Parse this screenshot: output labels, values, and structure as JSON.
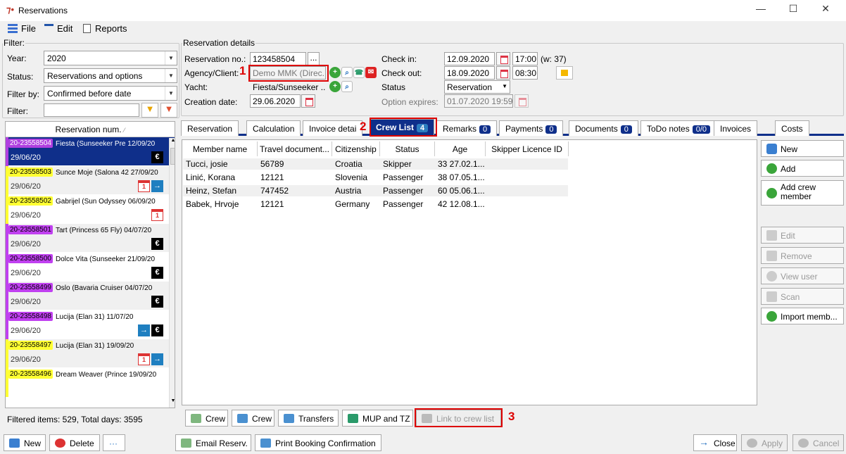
{
  "window": {
    "title": "Reservations",
    "min": "—",
    "max": "☐",
    "close": "✕"
  },
  "menu": {
    "file": "File",
    "edit": "Edit",
    "reports": "Reports"
  },
  "filter": {
    "legend": "Filter:",
    "year_label": "Year:",
    "year": "2020",
    "status_label": "Status:",
    "status": "Reservations and options",
    "filterby_label": "Filter by:",
    "filterby": "Confirmed before date",
    "filter_label": "Filter:",
    "filter_value": ""
  },
  "list": {
    "header": "Reservation num.",
    "footer": "Filtered items: 529,  Total days: 3595",
    "items": [
      {
        "id": "20-23558504",
        "title": "Fiesta (Sunseeker Pre 12/09/20",
        "date": "29/06/20"
      },
      {
        "id": "20-23558503",
        "title": "Sunce Moje (Salona 42 27/09/20",
        "date": "29/06/20"
      },
      {
        "id": "20-23558502",
        "title": "Gabrijel (Sun Odyssey 06/09/20",
        "date": "29/06/20"
      },
      {
        "id": "20-23558501",
        "title": "Tart (Princess 65 Fly) 04/07/20",
        "date": "29/06/20"
      },
      {
        "id": "20-23558500",
        "title": "Dolce Vita (Sunseeker 21/09/20",
        "date": "29/06/20"
      },
      {
        "id": "20-23558499",
        "title": "Oslo (Bavaria Cruiser  04/07/20",
        "date": "29/06/20"
      },
      {
        "id": "20-23558498",
        "title": "Lucija (Elan 31)          11/07/20",
        "date": "29/06/20"
      },
      {
        "id": "20-23558497",
        "title": "Lucija (Elan 31)          19/09/20",
        "date": "29/06/20"
      },
      {
        "id": "20-23558496",
        "title": "Dream Weaver (Prince 19/09/20",
        "date": ""
      }
    ]
  },
  "details": {
    "legend": "Reservation details",
    "resno_label": "Reservation no.:",
    "resno": "123458504",
    "agency_label": "Agency/Client:",
    "agency": "Demo MMK (Direc...",
    "yacht_label": "Yacht:",
    "yacht": "Fiesta/Sunseeker ...",
    "creation_label": "Creation date:",
    "creation": "29.06.2020",
    "checkin_label": "Check in:",
    "checkin": "12.09.2020",
    "checkin_time": "17:00",
    "week": "(w: 37)",
    "checkout_label": "Check out:",
    "checkout": "18.09.2020",
    "checkout_time": "08:30",
    "status_label": "Status",
    "status": "Reservation",
    "option_label": "Option expires:",
    "option": "01.07.2020 19:59",
    "dots": "..."
  },
  "tabs": [
    {
      "label": "Reservation",
      "count": ""
    },
    {
      "label": "Calculation",
      "count": ""
    },
    {
      "label": "Invoice detai",
      "count": ""
    },
    {
      "label": "Crew List",
      "count": "4"
    },
    {
      "label": "Remarks",
      "count": "0"
    },
    {
      "label": "Payments",
      "count": "0"
    },
    {
      "label": "Documents",
      "count": "0"
    },
    {
      "label": "ToDo notes",
      "count": "0/0"
    },
    {
      "label": "Invoices",
      "count": ""
    },
    {
      "label": "Costs",
      "count": ""
    }
  ],
  "grid": {
    "headers": [
      "Member name",
      "Travel document...",
      "Citizenship",
      "Status",
      "Age",
      "Skipper Licence ID"
    ],
    "rows": [
      [
        "Tucci, josie",
        "56789",
        "Croatia",
        "Skipper",
        "33 27.02.1...",
        ""
      ],
      [
        "Linić, Korana",
        "12121",
        "Slovenia",
        "Passenger",
        "38 07.05.1...",
        ""
      ],
      [
        "Heinz, Stefan",
        "747452",
        "Austria",
        "Passenger",
        "60 05.06.1...",
        ""
      ],
      [
        "Babek, Hrvoje",
        "12121",
        "Germany",
        "Passenger",
        "42 12.08.1...",
        ""
      ]
    ]
  },
  "side_buttons": [
    "New",
    "Add",
    "Add crew member",
    "Edit",
    "Remove",
    "View user",
    "Scan",
    "Import memb..."
  ],
  "tab_buttons": [
    "Crew",
    "Crew",
    "Transfers",
    "MUP and TZ",
    "Link to crew list"
  ],
  "bottom": {
    "new": "New",
    "delete": "Delete",
    "more": "···",
    "email": "Email Reserv.",
    "print": "Print Booking Confirmation",
    "close": "Close",
    "apply": "Apply",
    "cancel": "Cancel"
  },
  "annotations": [
    "1",
    "2",
    "3"
  ],
  "colors": {
    "accent": "#0f2f8a",
    "highlight": "#d00000",
    "green": "#3aa53a"
  }
}
